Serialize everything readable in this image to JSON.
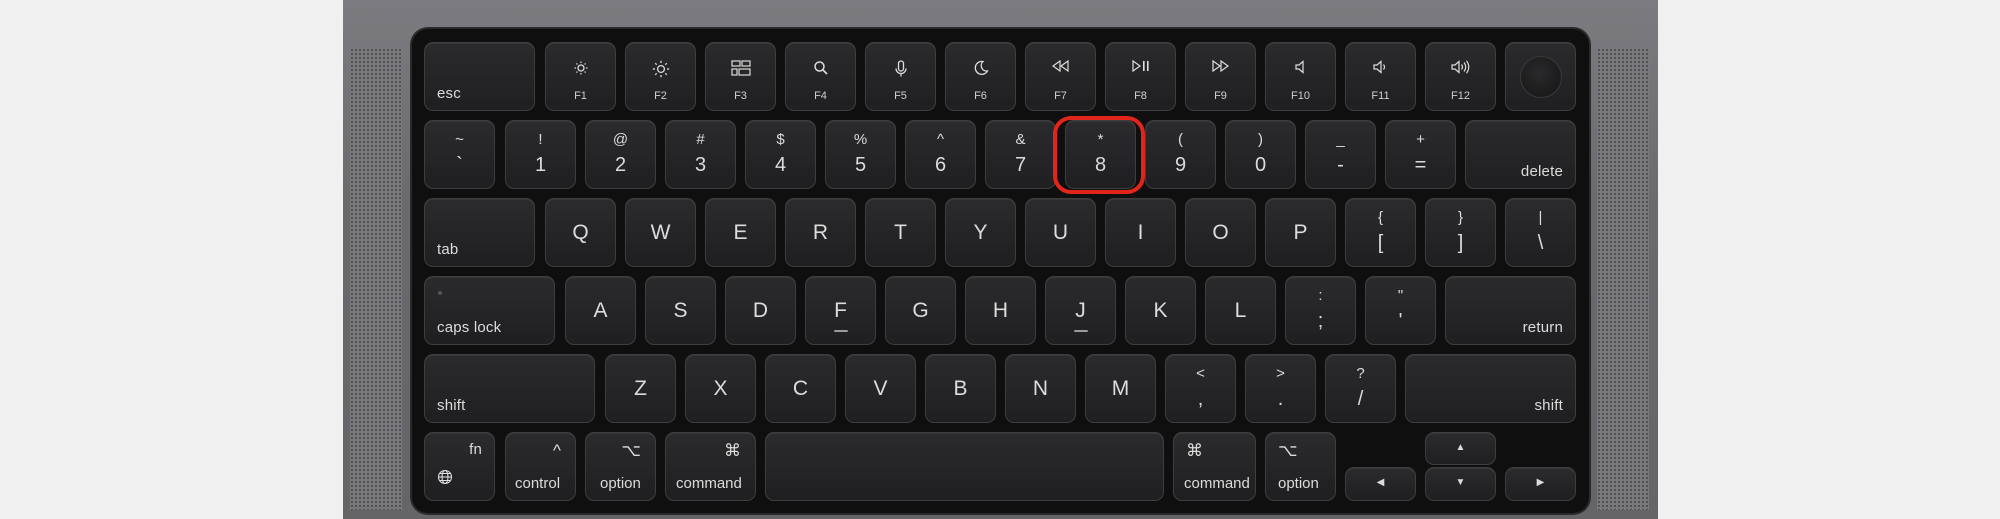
{
  "function_row": [
    {
      "id": "esc",
      "label": "esc"
    },
    {
      "id": "f1",
      "label": "F1",
      "icon": "brightness-down-icon"
    },
    {
      "id": "f2",
      "label": "F2",
      "icon": "brightness-up-icon"
    },
    {
      "id": "f3",
      "label": "F3",
      "icon": "mission-control-icon"
    },
    {
      "id": "f4",
      "label": "F4",
      "icon": "spotlight-search-icon"
    },
    {
      "id": "f5",
      "label": "F5",
      "icon": "dictation-microphone-icon"
    },
    {
      "id": "f6",
      "label": "F6",
      "icon": "do-not-disturb-moon-icon"
    },
    {
      "id": "f7",
      "label": "F7",
      "icon": "rewind-icon"
    },
    {
      "id": "f8",
      "label": "F8",
      "icon": "play-pause-icon"
    },
    {
      "id": "f9",
      "label": "F9",
      "icon": "fast-forward-icon"
    },
    {
      "id": "f10",
      "label": "F10",
      "icon": "mute-icon"
    },
    {
      "id": "f11",
      "label": "F11",
      "icon": "volume-down-icon"
    },
    {
      "id": "f12",
      "label": "F12",
      "icon": "volume-up-icon"
    }
  ],
  "number_row": [
    {
      "id": "grave",
      "top": "~",
      "bottom": "`"
    },
    {
      "id": "1",
      "top": "!",
      "bottom": "1"
    },
    {
      "id": "2",
      "top": "@",
      "bottom": "2"
    },
    {
      "id": "3",
      "top": "#",
      "bottom": "3"
    },
    {
      "id": "4",
      "top": "$",
      "bottom": "4"
    },
    {
      "id": "5",
      "top": "%",
      "bottom": "5"
    },
    {
      "id": "6",
      "top": "^",
      "bottom": "6"
    },
    {
      "id": "7",
      "top": "&",
      "bottom": "7"
    },
    {
      "id": "8",
      "top": "*",
      "bottom": "8"
    },
    {
      "id": "9",
      "top": "(",
      "bottom": "9"
    },
    {
      "id": "0",
      "top": ")",
      "bottom": "0"
    },
    {
      "id": "minus",
      "top": "_",
      "bottom": "-"
    },
    {
      "id": "equals",
      "top": "+",
      "bottom": "="
    },
    {
      "id": "delete",
      "label": "delete"
    }
  ],
  "qwerty_row": [
    {
      "id": "tab",
      "label": "tab"
    },
    {
      "id": "q",
      "label": "Q"
    },
    {
      "id": "w",
      "label": "W"
    },
    {
      "id": "e",
      "label": "E"
    },
    {
      "id": "r",
      "label": "R"
    },
    {
      "id": "t",
      "label": "T"
    },
    {
      "id": "y",
      "label": "Y"
    },
    {
      "id": "u",
      "label": "U"
    },
    {
      "id": "i",
      "label": "I"
    },
    {
      "id": "o",
      "label": "O"
    },
    {
      "id": "p",
      "label": "P"
    },
    {
      "id": "lbracket",
      "top": "{",
      "bottom": "["
    },
    {
      "id": "rbracket",
      "top": "}",
      "bottom": "]"
    },
    {
      "id": "backslash",
      "top": "|",
      "bottom": "\\"
    }
  ],
  "home_row": [
    {
      "id": "capslock",
      "label": "caps lock"
    },
    {
      "id": "a",
      "label": "A"
    },
    {
      "id": "s",
      "label": "S"
    },
    {
      "id": "d",
      "label": "D"
    },
    {
      "id": "f",
      "label": "F"
    },
    {
      "id": "g",
      "label": "G"
    },
    {
      "id": "h",
      "label": "H"
    },
    {
      "id": "j",
      "label": "J"
    },
    {
      "id": "k",
      "label": "K"
    },
    {
      "id": "l",
      "label": "L"
    },
    {
      "id": "semicolon",
      "top": ":",
      "bottom": ";"
    },
    {
      "id": "quote",
      "top": "\"",
      "bottom": "'"
    },
    {
      "id": "return",
      "label": "return"
    }
  ],
  "shift_row": [
    {
      "id": "lshift",
      "label": "shift"
    },
    {
      "id": "z",
      "label": "Z"
    },
    {
      "id": "x",
      "label": "X"
    },
    {
      "id": "c",
      "label": "C"
    },
    {
      "id": "v",
      "label": "V"
    },
    {
      "id": "b",
      "label": "B"
    },
    {
      "id": "n",
      "label": "N"
    },
    {
      "id": "m",
      "label": "M"
    },
    {
      "id": "comma",
      "top": "<",
      "bottom": ","
    },
    {
      "id": "period",
      "top": ">",
      "bottom": "."
    },
    {
      "id": "slash",
      "top": "?",
      "bottom": "/"
    },
    {
      "id": "rshift",
      "label": "shift"
    }
  ],
  "bottom_row": {
    "fn": {
      "label": "fn",
      "icon": "globe-icon"
    },
    "lcontrol": {
      "label": "control",
      "symbol": "^"
    },
    "loption": {
      "label": "option",
      "symbol": "⌥"
    },
    "lcommand": {
      "label": "command",
      "symbol": "⌘"
    },
    "rcommand": {
      "label": "command",
      "symbol": "⌘"
    },
    "roption": {
      "label": "option",
      "symbol": "⌥"
    },
    "arrows": {
      "up": "▲",
      "down": "▼",
      "left": "◀",
      "right": "▶"
    }
  },
  "highlighted_key": "8",
  "colors": {
    "highlight": "#e1251b",
    "key": "#252527",
    "deck": "#0f0f10",
    "chassis": "#6f6f72",
    "background": "#f1f0f1"
  }
}
